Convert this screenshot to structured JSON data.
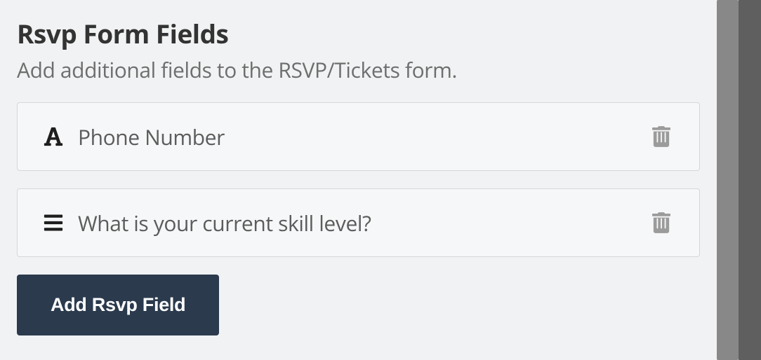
{
  "section": {
    "title": "Rsvp Form Fields",
    "subtitle": "Add additional fields to the RSVP/Tickets form."
  },
  "fields": [
    {
      "icon": "font-icon",
      "label": "Phone Number"
    },
    {
      "icon": "list-icon",
      "label": "What is your current skill level?"
    }
  ],
  "buttons": {
    "add_label": "Add Rsvp Field"
  }
}
